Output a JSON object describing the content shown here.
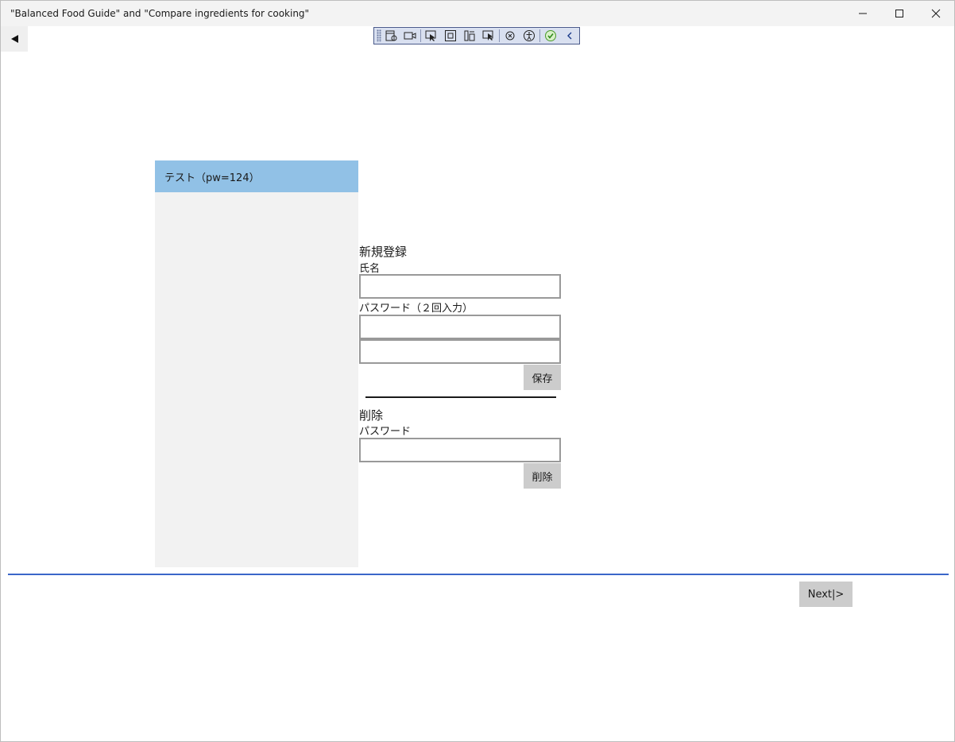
{
  "window": {
    "title": "\"Balanced Food Guide\" and \"Compare ingredients for cooking\""
  },
  "nav": {
    "back_icon": "back-arrow-icon"
  },
  "debug_toolbar": {
    "tools": [
      "live-visual-tree-icon",
      "record-icon",
      "select-element-icon",
      "display-layout-adorners-icon",
      "track-focus-icon",
      "hot-reload-icon",
      "binding-failures-icon",
      "accessibility-icon",
      "checkmark-icon",
      "collapse-chevron-icon"
    ]
  },
  "users": {
    "items": [
      {
        "label": "テスト（pw=124）"
      }
    ],
    "selected_color": "#91c1e6"
  },
  "register": {
    "heading": "新規登録",
    "name_label": "氏名",
    "name_value": "",
    "password_label": "パスワード（２回入力）",
    "password_value": "",
    "password_confirm_value": "",
    "save_label": "保存"
  },
  "delete_section": {
    "heading": "削除",
    "password_label": "パスワード",
    "password_value": "",
    "delete_label": "削除"
  },
  "footer": {
    "next_label": "Next|>",
    "divider_color": "#3a66c9"
  }
}
